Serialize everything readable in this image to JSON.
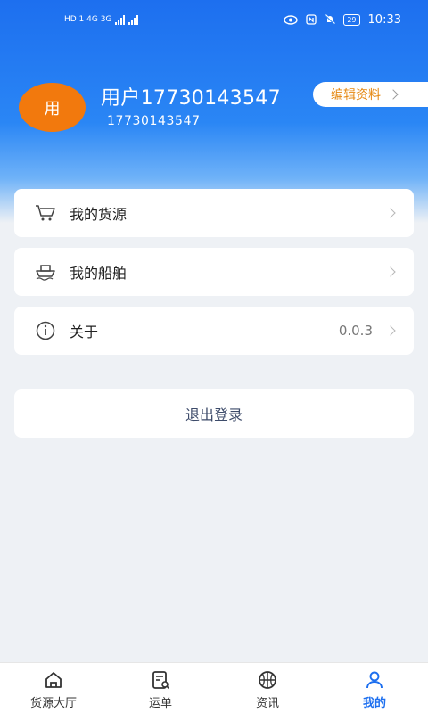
{
  "status_bar": {
    "left_text": "HD 1  4G  3G",
    "time": "10:33",
    "battery": "29"
  },
  "profile": {
    "avatar_text": "用",
    "name": "用户17730143547",
    "phone": "17730143547",
    "edit_label": "编辑资料"
  },
  "menu": {
    "items": [
      {
        "label": "我的货源",
        "value": ""
      },
      {
        "label": "我的船舶",
        "value": ""
      },
      {
        "label": "关于",
        "value": "0.0.3"
      }
    ]
  },
  "logout_label": "退出登录",
  "tabbar": {
    "tabs": [
      {
        "label": "货源大厅"
      },
      {
        "label": "运单"
      },
      {
        "label": "资讯"
      },
      {
        "label": "我的"
      }
    ],
    "active_color": "#1d6fef"
  },
  "colors": {
    "header_blue": "#1d6fef",
    "avatar_orange": "#f2790d",
    "edit_text": "#e5870f"
  }
}
